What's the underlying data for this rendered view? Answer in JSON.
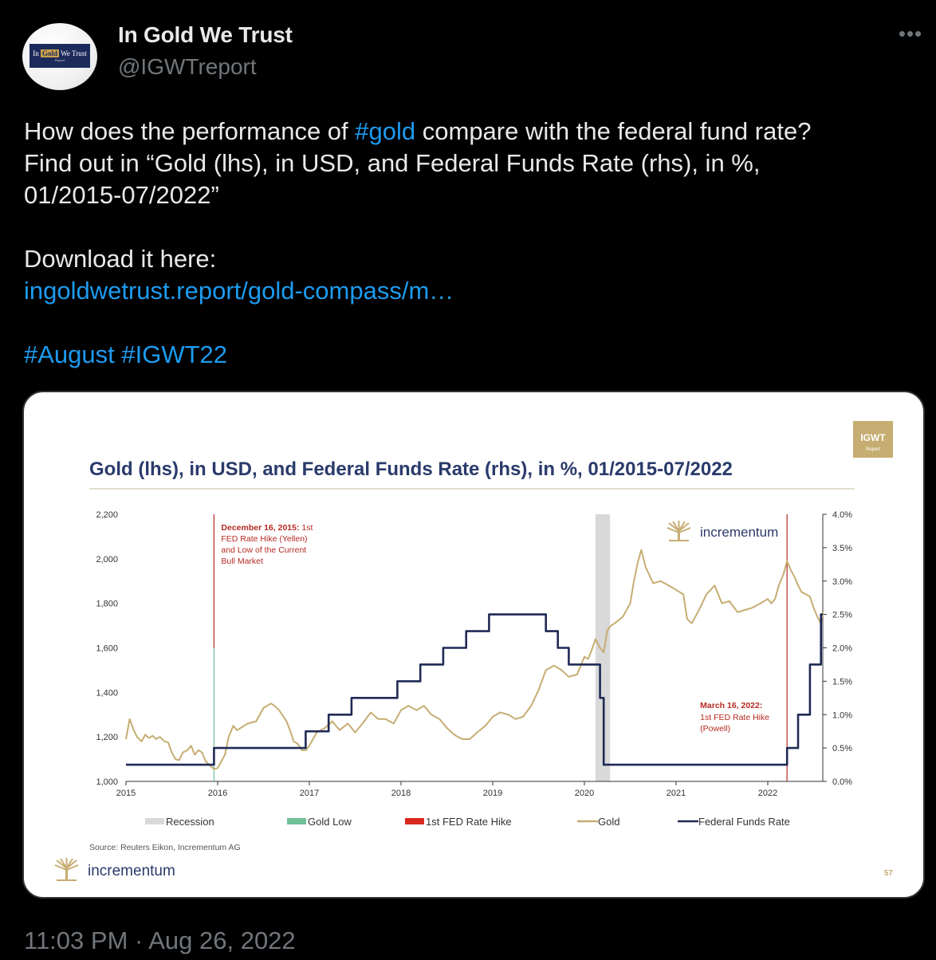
{
  "account": {
    "display_name": "In Gold We Trust",
    "handle": "@IGWTreport",
    "avatar_text_in": "In",
    "avatar_text_gold": "Gold",
    "avatar_text_we_trust": "We Trust",
    "avatar_text_report": "Report"
  },
  "more_icon": "more-horizontal-icon",
  "tweet": {
    "line1_pre": "How does the performance of ",
    "line1_tag": "#gold",
    "line1_post": " compare with the federal fund rate?",
    "line2": "Find out in “Gold (lhs), in USD, and Federal Funds Rate (rhs), in %,",
    "line3": "01/2015-07/2022”",
    "line4": "Download it here:",
    "link": "ingoldwetrust.report/gold-compass/m…",
    "tag1": "#August",
    "tag2": "#IGWT22",
    "timestamp": "11:03 PM · Aug 26, 2022"
  },
  "colors": {
    "link": "#1d9bf0",
    "gold_line": "#c6ad72",
    "fed_line": "#1f2a55",
    "annotation_red": "#b62a22",
    "recession": "#d9d9d9",
    "gold_low": "#6fbf98"
  },
  "chart_data": {
    "type": "line",
    "title": "Gold (lhs), in USD, and Federal Funds Rate (rhs), in %, 01/2015-07/2022",
    "corner_badge": "IGWT",
    "corner_badge_sub": "Report",
    "watermark": "incrementum",
    "footer_logo": "incrementum",
    "source": "Source: Reuters Eikon, Incrementum AG",
    "page_number": "57",
    "x_ticks": [
      "2015",
      "2016",
      "2017",
      "2018",
      "2019",
      "2020",
      "2021",
      "2022"
    ],
    "left_axis": {
      "ticks": [
        "1,000",
        "1,200",
        "1,400",
        "1,600",
        "1,800",
        "2,000",
        "2,200"
      ],
      "ylim": [
        1000,
        2200
      ]
    },
    "right_axis": {
      "ticks": [
        "0.0%",
        "0.5%",
        "1.0%",
        "1.5%",
        "2.0%",
        "2.5%",
        "3.0%",
        "3.5%",
        "4.0%"
      ],
      "ylim": [
        0,
        4
      ]
    },
    "xlim": [
      2015.0,
      2022.6
    ],
    "legend": [
      "Recession",
      "Gold Low",
      "1st FED Rate Hike",
      "Gold",
      "Federal Funds Rate"
    ],
    "recession": [
      2020.12,
      2020.28
    ],
    "gold_low_date": 2015.96,
    "annotations": [
      {
        "date": 2015.96,
        "bold": "December 16, 2015:",
        "text_after_bold": " 1st",
        "lines": [
          "FED Rate Hike (Yellen)",
          "and Low of the Current",
          "Bull Market"
        ]
      },
      {
        "date": 2022.21,
        "bold": "March 16, 2022:",
        "lines": [
          "1st FED Rate Hike",
          "(Powell)"
        ]
      }
    ],
    "series": [
      {
        "name": "Gold",
        "axis": "left",
        "x": [
          2015.0,
          2015.04,
          2015.08,
          2015.12,
          2015.17,
          2015.21,
          2015.25,
          2015.29,
          2015.33,
          2015.37,
          2015.42,
          2015.46,
          2015.5,
          2015.54,
          2015.58,
          2015.62,
          2015.67,
          2015.71,
          2015.75,
          2015.79,
          2015.83,
          2015.87,
          2015.92,
          2015.96,
          2016.0,
          2016.04,
          2016.08,
          2016.12,
          2016.17,
          2016.21,
          2016.25,
          2016.33,
          2016.42,
          2016.5,
          2016.54,
          2016.58,
          2016.62,
          2016.67,
          2016.75,
          2016.79,
          2016.83,
          2016.87,
          2016.92,
          2016.96,
          2017.0,
          2017.08,
          2017.17,
          2017.25,
          2017.33,
          2017.42,
          2017.5,
          2017.58,
          2017.67,
          2017.75,
          2017.83,
          2017.92,
          2018.0,
          2018.08,
          2018.17,
          2018.25,
          2018.33,
          2018.42,
          2018.5,
          2018.58,
          2018.62,
          2018.67,
          2018.75,
          2018.83,
          2018.92,
          2019.0,
          2019.08,
          2019.17,
          2019.25,
          2019.33,
          2019.42,
          2019.5,
          2019.58,
          2019.67,
          2019.75,
          2019.83,
          2019.92,
          2020.0,
          2020.04,
          2020.08,
          2020.12,
          2020.17,
          2020.21,
          2020.25,
          2020.29,
          2020.33,
          2020.42,
          2020.5,
          2020.54,
          2020.58,
          2020.62,
          2020.67,
          2020.75,
          2020.83,
          2020.92,
          2021.0,
          2021.04,
          2021.08,
          2021.12,
          2021.17,
          2021.25,
          2021.33,
          2021.42,
          2021.5,
          2021.58,
          2021.67,
          2021.75,
          2021.83,
          2021.92,
          2022.0,
          2022.04,
          2022.08,
          2022.12,
          2022.17,
          2022.21,
          2022.25,
          2022.29,
          2022.33,
          2022.37,
          2022.42,
          2022.46,
          2022.5,
          2022.54,
          2022.58,
          2022.6
        ],
        "values": [
          1190,
          1280,
          1235,
          1200,
          1180,
          1210,
          1195,
          1205,
          1190,
          1200,
          1180,
          1175,
          1130,
          1100,
          1095,
          1130,
          1140,
          1160,
          1120,
          1140,
          1130,
          1090,
          1070,
          1055,
          1060,
          1090,
          1120,
          1200,
          1250,
          1230,
          1240,
          1260,
          1270,
          1330,
          1340,
          1350,
          1340,
          1320,
          1270,
          1230,
          1180,
          1170,
          1140,
          1140,
          1160,
          1220,
          1240,
          1270,
          1230,
          1260,
          1220,
          1260,
          1310,
          1280,
          1280,
          1260,
          1320,
          1340,
          1320,
          1340,
          1300,
          1280,
          1240,
          1210,
          1200,
          1190,
          1190,
          1220,
          1250,
          1290,
          1310,
          1300,
          1280,
          1290,
          1340,
          1410,
          1500,
          1520,
          1500,
          1470,
          1480,
          1560,
          1550,
          1590,
          1640,
          1600,
          1580,
          1680,
          1700,
          1710,
          1740,
          1800,
          1900,
          1980,
          2040,
          1960,
          1890,
          1900,
          1880,
          1860,
          1850,
          1840,
          1730,
          1710,
          1770,
          1840,
          1880,
          1800,
          1810,
          1760,
          1770,
          1780,
          1800,
          1820,
          1800,
          1820,
          1880,
          1930,
          1990,
          1950,
          1920,
          1880,
          1850,
          1840,
          1830,
          1780,
          1740,
          1710,
          1760
        ]
      },
      {
        "name": "Federal Funds Rate",
        "axis": "right",
        "x": [
          2015.0,
          2015.96,
          2015.96,
          2016.96,
          2016.96,
          2017.21,
          2017.21,
          2017.46,
          2017.46,
          2017.96,
          2017.96,
          2018.21,
          2018.21,
          2018.46,
          2018.46,
          2018.71,
          2018.71,
          2018.96,
          2018.96,
          2019.58,
          2019.58,
          2019.71,
          2019.71,
          2019.83,
          2019.83,
          2020.17,
          2020.17,
          2020.21,
          2020.21,
          2022.21,
          2022.21,
          2022.33,
          2022.33,
          2022.46,
          2022.46,
          2022.58,
          2022.58,
          2022.6
        ],
        "values": [
          0.25,
          0.25,
          0.5,
          0.5,
          0.75,
          0.75,
          1.0,
          1.0,
          1.25,
          1.25,
          1.5,
          1.5,
          1.75,
          1.75,
          2.0,
          2.0,
          2.25,
          2.25,
          2.5,
          2.5,
          2.25,
          2.25,
          2.0,
          2.0,
          1.75,
          1.75,
          1.25,
          1.25,
          0.25,
          0.25,
          0.5,
          0.5,
          1.0,
          1.0,
          1.75,
          1.75,
          2.5,
          2.5
        ]
      }
    ]
  }
}
